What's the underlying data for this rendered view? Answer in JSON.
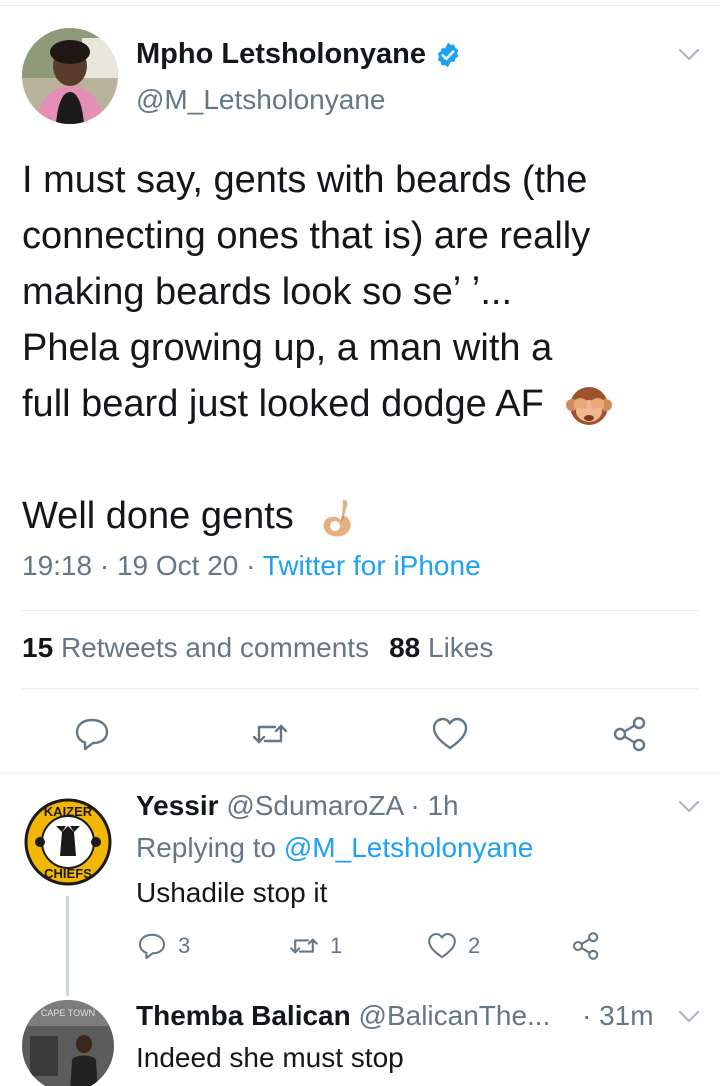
{
  "main_tweet": {
    "display_name": "Mpho Letsholonyane",
    "handle": "@M_Letsholonyane",
    "text_lines": [
      "I must say, gents with beards (the",
      "connecting ones that is) are really",
      "making beards look so seʼ ʼ...",
      "Phela growing up, a man with a",
      "full beard just looked dodge AF"
    ],
    "text_last": "Well done gents",
    "time": "19:18",
    "date": "19 Oct 20",
    "sep": "·",
    "source": "Twitter for iPhone",
    "retweets_count": "15",
    "retweets_label": "Retweets and comments",
    "likes_count": "88",
    "likes_label": "Likes",
    "icons": {
      "reply": "reply-icon",
      "retweet": "retweet-icon",
      "like": "heart-icon",
      "share": "share-icon",
      "verified": "verified-badge-icon"
    }
  },
  "replies": [
    {
      "display_name": "Yessir",
      "handle": "@SdumaroZA",
      "time": "· 1h",
      "replying_prefix": "Replying to",
      "replying_to": "@M_Letsholonyane",
      "text": "Ushadile stop it",
      "reply_count": "3",
      "retweet_count": "1",
      "like_count": "2",
      "avatar_text_top": "KAIZER",
      "avatar_text_bottom": "CHIEFS"
    },
    {
      "display_name": "Themba Balican",
      "handle": "@BalicanThe...",
      "time": "· 31m",
      "text": "Indeed she must stop",
      "avatar_text": "CAPE TOWN"
    }
  ],
  "colors": {
    "accent": "#1da1f2",
    "secondary_text": "#657786",
    "primary_text": "#14171a",
    "divider": "#e6ecf0"
  }
}
